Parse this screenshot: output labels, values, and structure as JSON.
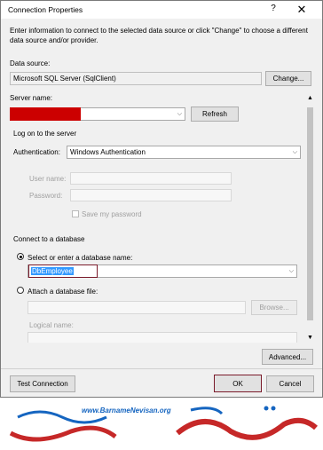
{
  "window": {
    "title": "Connection Properties",
    "help_glyph": "?",
    "close_glyph": "✕"
  },
  "intro": "Enter information to connect to the selected data source or click \"Change\" to choose a different data source and/or provider.",
  "data_source": {
    "label": "Data source:",
    "value": "Microsoft SQL Server (SqlClient)",
    "change_label": "Change..."
  },
  "server": {
    "label": "Server name:",
    "value": "",
    "refresh_label": "Refresh"
  },
  "logon": {
    "section_label": "Log on to the server",
    "auth_label": "Authentication:",
    "auth_value": "Windows Authentication",
    "user_label": "User name:",
    "password_label": "Password:",
    "save_password_label": "Save my password"
  },
  "database": {
    "section_label": "Connect to a database",
    "select_option_label": "Select or enter a database name:",
    "db_value": "DbEmployee",
    "attach_option_label": "Attach a database file:",
    "browse_label": "Browse...",
    "logical_name_label": "Logical name:"
  },
  "advanced_label": "Advanced...",
  "footer": {
    "test_label": "Test Connection",
    "ok_label": "OK",
    "cancel_label": "Cancel"
  },
  "banner": {
    "url": "www.BarnameNevisan.org"
  },
  "colors": {
    "accent": "#7a1a2a",
    "brand_blue": "#1565c0",
    "brand_red": "#c62828",
    "redaction": "#cc0000",
    "selection": "#3399ff"
  }
}
